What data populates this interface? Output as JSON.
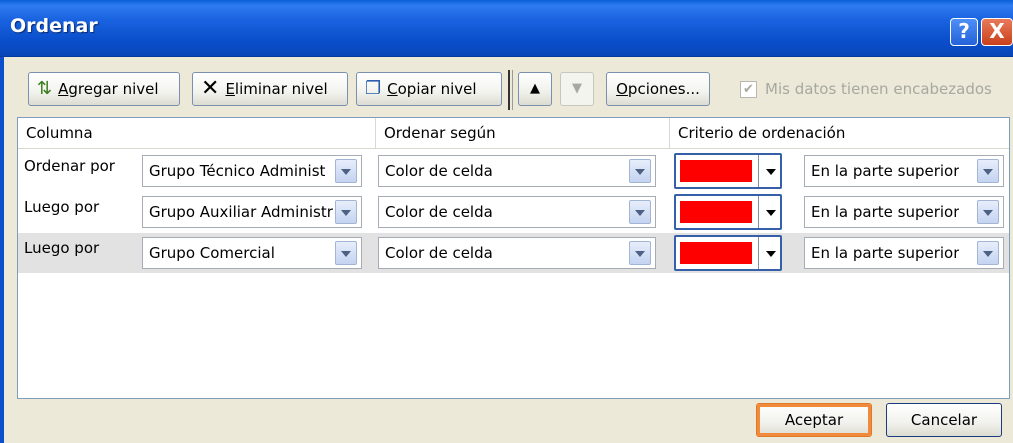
{
  "window": {
    "title": "Ordenar",
    "help_label": "?",
    "close_label": "X"
  },
  "toolbar": {
    "add_level": {
      "prefix": "",
      "accel": "A",
      "rest": "gregar nivel"
    },
    "delete_level": {
      "accel": "E",
      "rest": "liminar nivel"
    },
    "copy_level": {
      "accel": "C",
      "rest": "opiar nivel"
    },
    "options": {
      "accel": "O",
      "rest": "pciones..."
    },
    "headers_checkbox": {
      "label": "Mis datos tienen encabezados",
      "checked": true,
      "enabled": false
    }
  },
  "grid": {
    "headers": {
      "column": "Columna",
      "sort_on": "Ordenar según",
      "order": "Criterio de ordenación"
    },
    "rows": [
      {
        "label": "Ordenar por",
        "column": "Grupo Técnico Administ",
        "sort_on": "Color de celda",
        "color": "#ff0000",
        "order": "En la parte superior"
      },
      {
        "label": "Luego por",
        "column": "Grupo Auxiliar Administr",
        "sort_on": "Color de celda",
        "color": "#ff0000",
        "order": "En la parte superior"
      },
      {
        "label": "Luego por",
        "column": "Grupo Comercial",
        "sort_on": "Color de celda",
        "color": "#ff0000",
        "order": "En la parte superior"
      }
    ]
  },
  "footer": {
    "ok": "Aceptar",
    "cancel": "Cancelar"
  },
  "colors": {
    "titlebar": "#0b4fcd",
    "selected_swatch": "#ff0000",
    "default_button_focus": "#f28a3c"
  },
  "icons": [
    "add-level-icon",
    "delete-icon",
    "copy-icon",
    "move-up-icon",
    "move-down-icon",
    "help-icon",
    "close-icon"
  ]
}
